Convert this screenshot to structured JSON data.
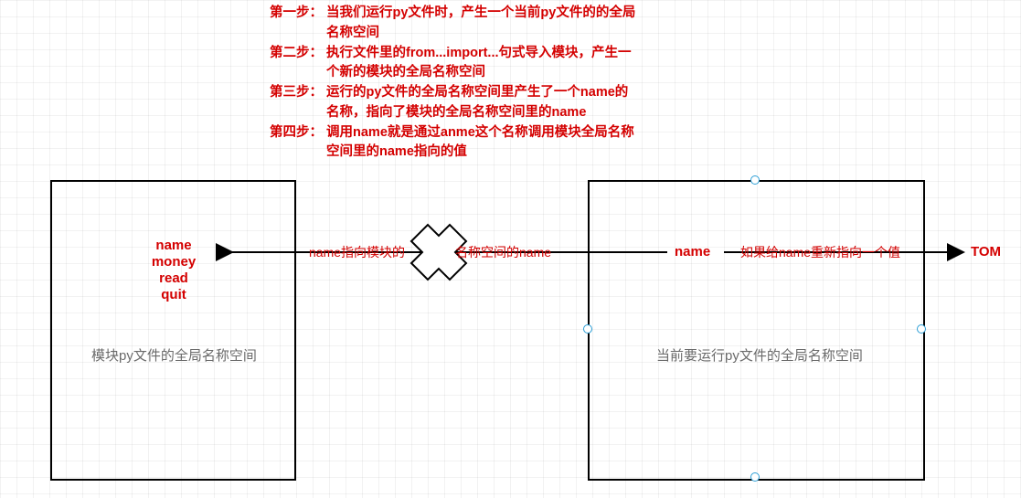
{
  "steps": [
    {
      "label": "第一步：",
      "body_line1": "当我们运行py文件时，产生一个当前py文件的的全局",
      "body_line2": "名称空间"
    },
    {
      "label": "第二步：",
      "body_line1": "执行文件里的from...import...句式导入模块，产生一",
      "body_line2": "个新的模块的全局名称空间"
    },
    {
      "label": "第三步：",
      "body_line1": "运行的py文件的全局名称空间里产生了一个name的",
      "body_line2": "名称，指向了模块的全局名称空间里的name"
    },
    {
      "label": "第四步：",
      "body_line1": "调用name就是通过anme这个名称调用模块全局名称",
      "body_line2": "空间里的name指向的值"
    }
  ],
  "left_box": {
    "vars": [
      "name",
      "money",
      "read",
      "quit"
    ],
    "caption": "模块py文件的全局名称空间"
  },
  "right_box": {
    "name_label": "name",
    "caption": "当前要运行py文件的全局名称空间"
  },
  "arrow_left_label_part1": "name指向模块的",
  "arrow_left_label_part2": "名称空间的name",
  "arrow_right_label": "如果给name重新指向一个值",
  "tom_label": "TOM"
}
